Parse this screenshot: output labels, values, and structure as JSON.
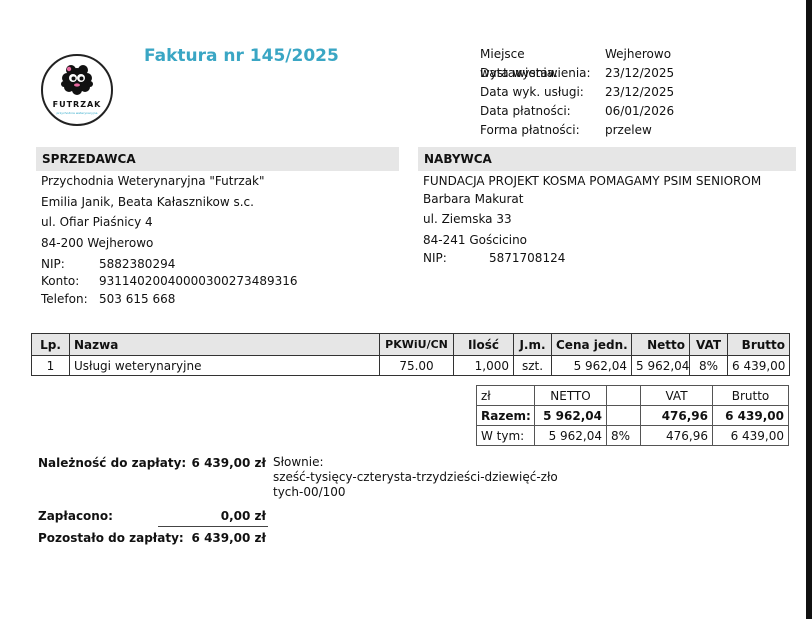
{
  "logo": {
    "name": "FUTRZAK",
    "sub": "przychodnia weterynaryjna"
  },
  "invoice": {
    "title": "Faktura nr 145/2025"
  },
  "meta": [
    {
      "label": "Miejsce wystawienia:",
      "value": "Wejherowo"
    },
    {
      "label": "Data wystawienia:",
      "value": "23/12/2025"
    },
    {
      "label": "Data wyk. usługi:",
      "value": "23/12/2025"
    },
    {
      "label": "Data płatności:",
      "value": "06/01/2026"
    },
    {
      "label": "Forma płatności:",
      "value": "przelew"
    }
  ],
  "seller": {
    "heading": "SPRZEDAWCA",
    "name": "Przychodnia Weterynaryjna \"Futrzak\"",
    "owners": "Emilia Janik, Beata Kałasznikow s.c.",
    "street": "ul. Ofiar Piaśnicy 4",
    "city": "84-200 Wejherowo",
    "nip_label": "NIP:",
    "nip": "5882380294",
    "account_label": "Konto:",
    "account": "93114020040000300273489316",
    "phone_label": "Telefon:",
    "phone": "503 615 668"
  },
  "buyer": {
    "heading": "NABYWCA",
    "name": "FUNDACJA PROJEKT KOSMA POMAGAMY PSIM SENIOROM",
    "person": "Barbara Makurat",
    "street": "ul. Ziemska 33",
    "city": "84-241 Gościcino",
    "nip_label": "NIP:",
    "nip": "5871708124"
  },
  "items_table": {
    "headers": [
      "Lp.",
      "Nazwa",
      "PKWiU/CN",
      "Ilość",
      "J.m.",
      "Cena jedn.",
      "Netto",
      "VAT",
      "Brutto"
    ],
    "rows": [
      [
        "1",
        "Usługi weterynaryjne",
        "75.00",
        "1,000",
        "szt.",
        "5 962,04",
        "5 962,04",
        "8%",
        "6 439,00"
      ]
    ]
  },
  "summary": {
    "currency": "zł",
    "netto_h": "NETTO",
    "vat_h": "VAT",
    "brutto_h": "Brutto",
    "total_label": "Razem:",
    "total_netto": "5 962,04",
    "total_vat": "476,96",
    "total_brutto": "6 439,00",
    "incl_label": "W tym:",
    "incl_netto": "5 962,04",
    "incl_rate": "8%",
    "incl_vat": "476,96",
    "incl_brutto": "6 439,00"
  },
  "payment": {
    "due_label": "Należność do zapłaty:",
    "due_value": "6 439,00 zł",
    "words_label": "Słownie:",
    "words_line1": "sześć-tysięcy-czterysta-trzydzieści-dziewięć-zło",
    "words_line2": "tych-00/100",
    "paid_label": "Zapłacono:",
    "paid_value": "0,00 zł",
    "remaining_label": "Pozostało do zapłaty:",
    "remaining_value": "6 439,00 zł"
  }
}
